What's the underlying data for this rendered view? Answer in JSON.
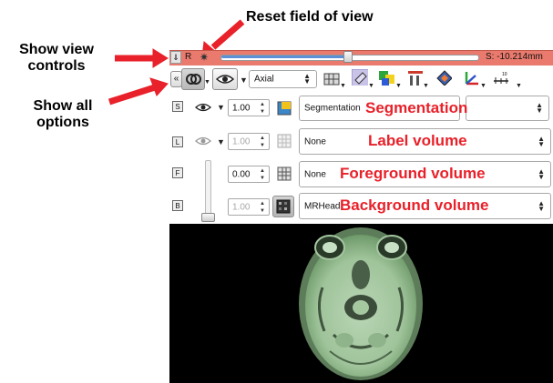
{
  "annotations": {
    "show_view_controls": [
      "Show view",
      "controls"
    ],
    "show_all_options": [
      "Show all",
      "options"
    ],
    "reset_field_of_view": "Reset field of view",
    "segmentation": "Segmentation",
    "label_volume": "Label volume",
    "foreground_volume": "Foreground volume",
    "background_volume": "Background volume"
  },
  "slice_bar": {
    "orientation_letter": "R",
    "offset_label": "S: -10.214mm",
    "slider_position": 0.5,
    "color": "#e97a6d"
  },
  "toolbar": {
    "collapse_label": "«",
    "view_orientation": "Axial"
  },
  "layers": {
    "segmentation": {
      "opacity": "1.00",
      "selected": "Segmentation"
    },
    "label": {
      "opacity": "1.00",
      "selected": "None"
    },
    "foreground": {
      "opacity": "0.00",
      "selected": "None"
    },
    "background": {
      "opacity": "1.00",
      "selected": "MRHead"
    }
  },
  "colors": {
    "annotation_red": "#e8212a",
    "arrow_red": "#e8212a",
    "accent_blue": "#5b8fd6",
    "viewer_background": "#000000"
  }
}
